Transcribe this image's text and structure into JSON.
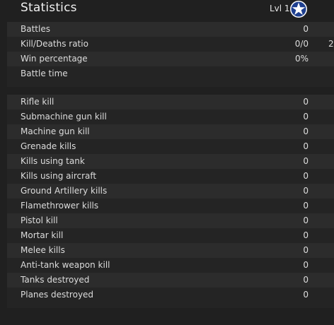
{
  "header": {
    "title": "Statistics",
    "level": "Lvl 1",
    "rank_icon": "star-icon"
  },
  "summary": [
    {
      "label": "Battles",
      "value": "0",
      "extra": ""
    },
    {
      "label": "Kill/Deaths ratio",
      "value": "0/0",
      "extra": "2"
    },
    {
      "label": "Win percentage",
      "value": "0%",
      "extra": ""
    },
    {
      "label": "Battle time",
      "value": "",
      "extra": ""
    }
  ],
  "kills": [
    {
      "label": "Rifle kill",
      "value": "0"
    },
    {
      "label": "Submachine gun kill",
      "value": "0"
    },
    {
      "label": "Machine gun kill",
      "value": "0"
    },
    {
      "label": "Grenade kills",
      "value": "0"
    },
    {
      "label": "Kills using tank",
      "value": "0"
    },
    {
      "label": "Kills using aircraft",
      "value": "0"
    },
    {
      "label": "Ground Artillery kills",
      "value": "0"
    },
    {
      "label": "Flamethrower kills",
      "value": "0"
    },
    {
      "label": "Pistol kill",
      "value": "0"
    },
    {
      "label": "Mortar kill",
      "value": "0"
    },
    {
      "label": "Melee kills",
      "value": "0"
    },
    {
      "label": "Anti-tank weapon kill",
      "value": "0"
    },
    {
      "label": "Tanks destroyed",
      "value": "0"
    },
    {
      "label": "Planes destroyed",
      "value": "0"
    }
  ],
  "colors": {
    "background": "#202020",
    "row_odd": "#2c2c2c",
    "row_even": "#242424",
    "star_badge": "#1e3f8f"
  }
}
